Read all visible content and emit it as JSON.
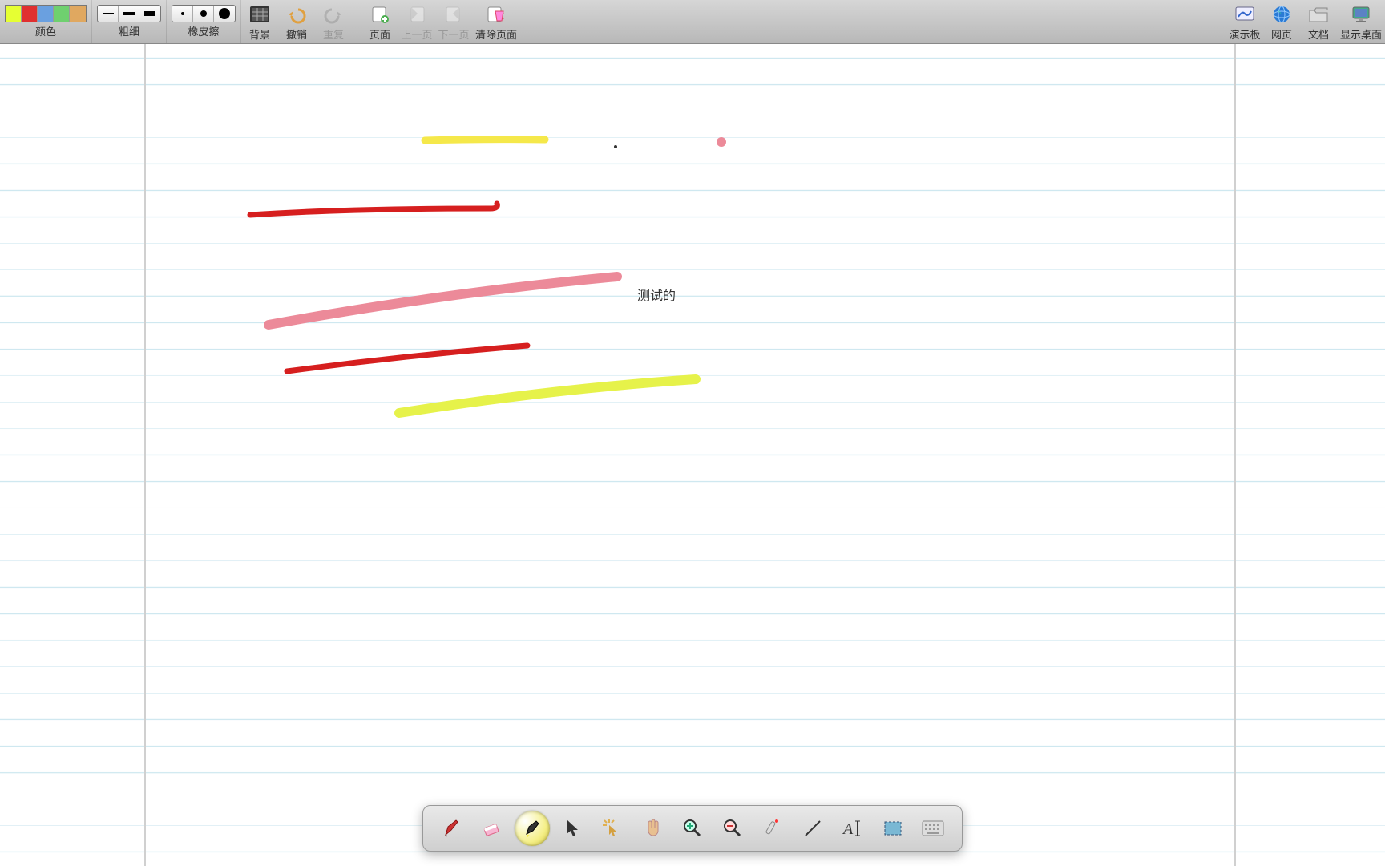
{
  "toolbar": {
    "color": {
      "label": "颜色",
      "swatches": [
        "#e6ff33",
        "#e03030",
        "#6aa0e0",
        "#6fd06f",
        "#e0a860"
      ]
    },
    "thickness": {
      "label": "粗细"
    },
    "eraser": {
      "label": "橡皮擦"
    },
    "background": {
      "label": "背景"
    },
    "undo": {
      "label": "撤销"
    },
    "redo": {
      "label": "重复"
    },
    "page": {
      "label": "页面"
    },
    "prev": {
      "label": "上一页"
    },
    "next": {
      "label": "下一页"
    },
    "clear": {
      "label": "清除页面"
    },
    "board": {
      "label": "演示板"
    },
    "web": {
      "label": "网页"
    },
    "docs": {
      "label": "文档"
    },
    "desktop": {
      "label": "显示桌面"
    }
  },
  "canvas": {
    "text_annotation": "测试的"
  },
  "bottom_tools": {
    "pen": "pen-icon",
    "eraser": "eraser-icon",
    "highlighter": "highlighter-icon",
    "pointer": "pointer-icon",
    "click": "click-icon",
    "hand": "hand-icon",
    "zoom_in": "zoom-in-icon",
    "zoom_out": "zoom-out-icon",
    "laser": "laser-icon",
    "line": "line-icon",
    "text": "text-icon",
    "select": "select-icon",
    "keyboard": "keyboard-icon"
  }
}
